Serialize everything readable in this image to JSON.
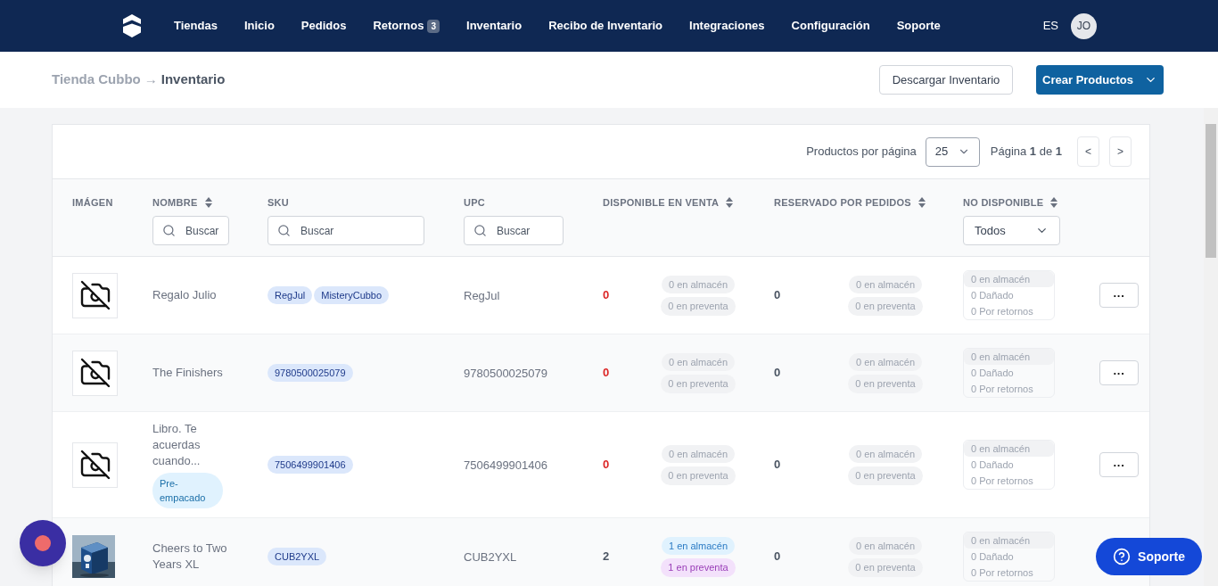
{
  "nav": {
    "items": [
      {
        "label": "Tiendas"
      },
      {
        "label": "Inicio"
      },
      {
        "label": "Pedidos"
      },
      {
        "label": "Retornos",
        "badge": "3"
      },
      {
        "label": "Inventario"
      },
      {
        "label": "Recibo de Inventario"
      },
      {
        "label": "Integraciones"
      },
      {
        "label": "Configuración"
      },
      {
        "label": "Soporte"
      }
    ],
    "language": "ES",
    "avatar": "JO"
  },
  "header": {
    "breadcrumb": {
      "parent": "Tienda Cubbo",
      "arrow": "→",
      "current": "Inventario"
    },
    "buttons": [
      {
        "label": "Descargar Inventario",
        "kind": "secondary"
      },
      {
        "label": "Crear Productos",
        "kind": "primary"
      }
    ]
  },
  "pagination": {
    "per_page_label": "Productos por página",
    "per_page": "25",
    "page_text": "Página **1** de **1**",
    "prev": "<",
    "next": ">"
  },
  "table": {
    "columns": [
      {
        "label": "IMÁGEN",
        "sortable": false,
        "kind": "plain"
      },
      {
        "label": "NOMBRE",
        "sortable": true,
        "kind": "search",
        "placeholder": "Buscar"
      },
      {
        "label": "SKU",
        "sortable": false,
        "kind": "search",
        "placeholder": "Buscar"
      },
      {
        "label": "UPC",
        "sortable": false,
        "kind": "search",
        "placeholder": "Buscar"
      },
      {
        "label": "DISPONIBLE EN VENTA",
        "sortable": true,
        "kind": "plain"
      },
      {
        "label": "RESERVADO POR PEDIDOS",
        "sortable": true,
        "kind": "plain"
      },
      {
        "label": "NO DISPONIBLE",
        "sortable": true,
        "kind": "select",
        "value": "Todos"
      }
    ],
    "rows": [
      {
        "kind": "placeholder",
        "name": "Regalo Julio",
        "tags": [],
        "skus": [
          "RegJul",
          "MisteryCubbo"
        ],
        "upc": "RegJul",
        "available": "0",
        "out_of_stock": true,
        "available_detail": [
          {
            "text": "0 en almacén",
            "highlighted": false
          },
          {
            "text": "0 en preventa",
            "highlighted": false
          }
        ],
        "reserved": "0",
        "reserved_detail": [
          "0 en almacén",
          "0 en preventa"
        ],
        "unavailable": [
          "0 en almacén",
          "0 Dañado",
          "0 Por retornos"
        ],
        "menu": "···"
      },
      {
        "kind": "placeholder",
        "name": "The Finishers",
        "tags": [],
        "skus": [
          "9780500025079"
        ],
        "upc": "9780500025079",
        "available": "0",
        "out_of_stock": true,
        "available_detail": [
          {
            "text": "0 en almacén",
            "highlighted": false
          },
          {
            "text": "0 en preventa",
            "highlighted": false
          }
        ],
        "reserved": "0",
        "reserved_detail": [
          "0 en almacén",
          "0 en preventa"
        ],
        "unavailable": [
          "0 en almacén",
          "0 Dañado",
          "0 Por retornos"
        ],
        "menu": "···"
      },
      {
        "kind": "placeholder",
        "name": "Libro. Te acuerdas cuando...",
        "tags": [
          "Pre-empacado"
        ],
        "skus": [
          "7506499901406"
        ],
        "upc": "7506499901406",
        "available": "0",
        "out_of_stock": true,
        "available_detail": [
          {
            "text": "0 en almacén",
            "highlighted": false
          },
          {
            "text": "0 en preventa",
            "highlighted": false
          }
        ],
        "reserved": "0",
        "reserved_detail": [
          "0 en almacén",
          "0 en preventa"
        ],
        "unavailable": [
          "0 en almacén",
          "0 Dañado",
          "0 Por retornos"
        ],
        "menu": "···"
      },
      {
        "kind": "picture",
        "name": "Cheers to Two Years XL",
        "tags": [],
        "skus": [
          "CUB2YXL"
        ],
        "upc": "CUB2YXL",
        "available": "2",
        "out_of_stock": false,
        "available_detail": [
          {
            "text": "1 en almacén",
            "highlighted": true
          },
          {
            "text": "1 en preventa",
            "highlighted": true
          }
        ],
        "reserved": "0",
        "reserved_detail": [
          "0 en almacén",
          "0 en preventa"
        ],
        "unavailable": [
          "0 en almacén",
          "0 Dañado",
          "0 Por retornos"
        ]
      }
    ]
  },
  "support_button": {
    "label": "Soporte"
  }
}
